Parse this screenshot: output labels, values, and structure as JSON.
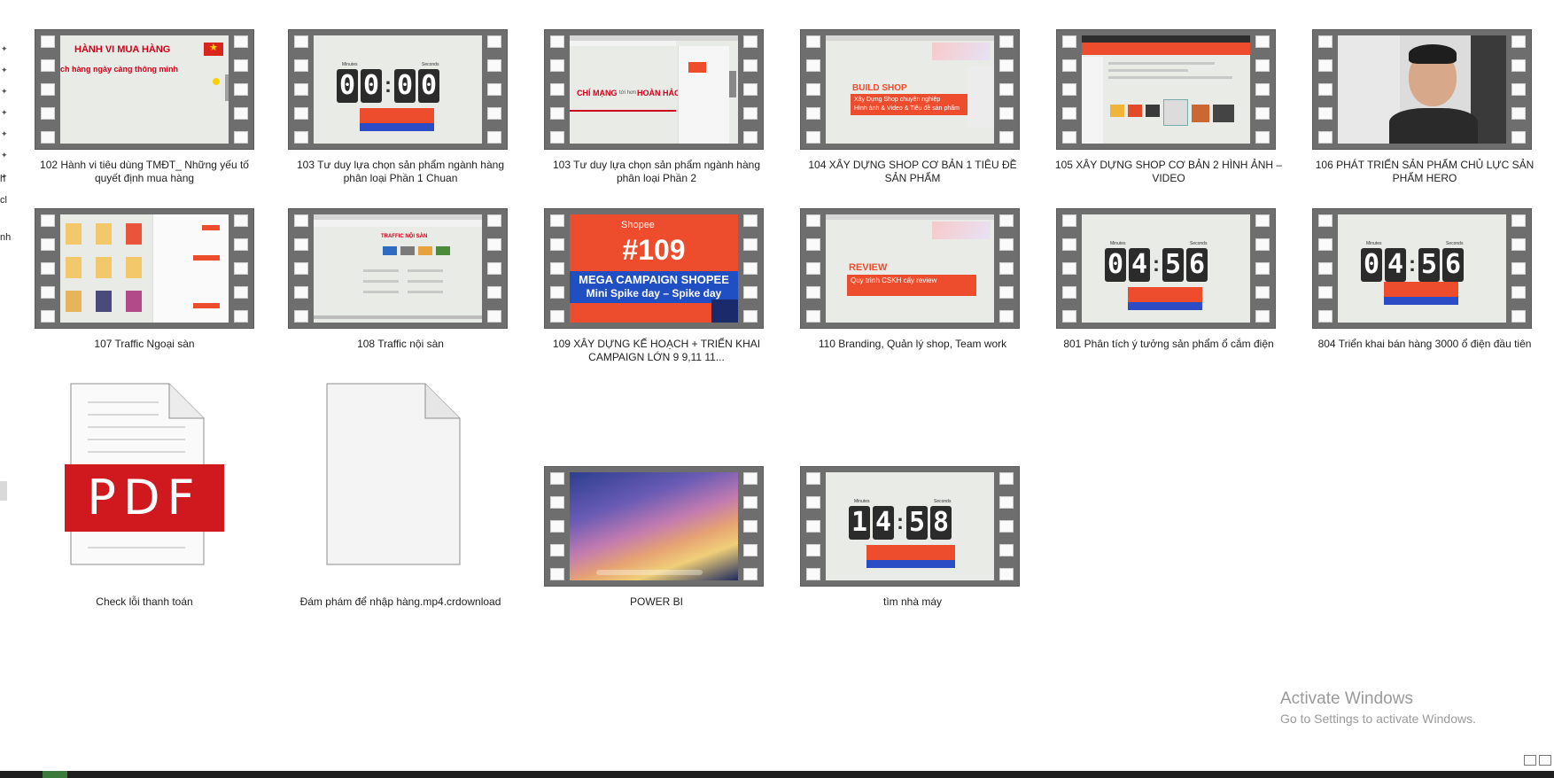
{
  "nav_pane": {
    "fragments": [
      "h",
      "cl",
      "nh"
    ]
  },
  "files": [
    {
      "label": "102 Hành vi tiêu dùng TMĐT_ Những yếu tố quyết định mua hàng",
      "thumb_title": "HÀNH VI MUA HÀNG",
      "thumb_sub": "ch hàng ngày càng thông minh"
    },
    {
      "label": "103 Tư duy lựa chọn sản phẩm ngành hàng phân loại   Phần 1 Chuan",
      "timer": "00:00",
      "cap_min": "Minutes",
      "cap_sec": "Seconds"
    },
    {
      "label": "103 Tư duy lựa chọn sản phẩm ngành hàng phân loại   Phần 2",
      "thumb_title": "CHÍ MẠNG",
      "thumb_mid": "tới hơn",
      "thumb_end": "HOÀN HẢO"
    },
    {
      "label": "104 XÂY DỰNG SHOP CƠ BẢN 1 TIÊU ĐỀ SẢN PHẨM",
      "thumb_title": "BUILD SHOP",
      "thumb_l1": "Xây Dựng Shop chuyên nghiệp",
      "thumb_l2": "Hình ảnh & Video & Tiêu đề sản phẩm"
    },
    {
      "label": "105 XÂY DỰNG SHOP CƠ BẢN 2 HÌNH ẢNH – VIDEO"
    },
    {
      "label": "106 PHÁT TRIỂN SẢN PHẨM CHỦ LỰC  SẢN PHẨM HERO"
    },
    {
      "label": "107 Traffic Ngoại sàn"
    },
    {
      "label": "108 Traffic nội sàn",
      "thumb_title": "TRAFFIC NỘI SÀN"
    },
    {
      "label": "109 XÂY DỰNG KẾ HOẠCH + TRIỂN KHAI CAMPAIGN LỚN 9 9,11 11...",
      "thumb_logo": "Shopee",
      "thumb_num": "#109",
      "thumb_l1": "MEGA CAMPAIGN SHOPEE",
      "thumb_l2": "Mini Spike day – Spike day"
    },
    {
      "label": "110 Branding, Quản lý shop, Team work",
      "thumb_title": "REVIEW",
      "thumb_l1": "Quy trình CSKH cấy review"
    },
    {
      "label": "801 Phân tích ý tưởng sản phẩm ổ cắm điện",
      "timer": "04:56",
      "cap_min": "Minutes",
      "cap_sec": "Seconds"
    },
    {
      "label": "804 Triển khai bán hàng 3000 ổ điện đầu tiên",
      "timer": "04:56",
      "cap_min": "Minutes",
      "cap_sec": "Seconds"
    },
    {
      "label": "Check lỗi thanh toán",
      "badge": "PDF"
    },
    {
      "label": "Đám phám để nhập hàng.mp4.crdownload"
    },
    {
      "label": "POWER BI"
    },
    {
      "label": "tìm nhà máy",
      "timer": "14:58",
      "cap_min": "Minutes",
      "cap_sec": "Seconds"
    }
  ],
  "watermark": {
    "line1": "Activate Windows",
    "line2": "Go to Settings to activate Windows."
  },
  "colors": {
    "film": "#6e6e6e",
    "shopee_orange": "#ee4d2d",
    "shopee_blue": "#1f4fc2",
    "pdf_red": "#d0191f",
    "watermark": "#9a9a9a"
  }
}
